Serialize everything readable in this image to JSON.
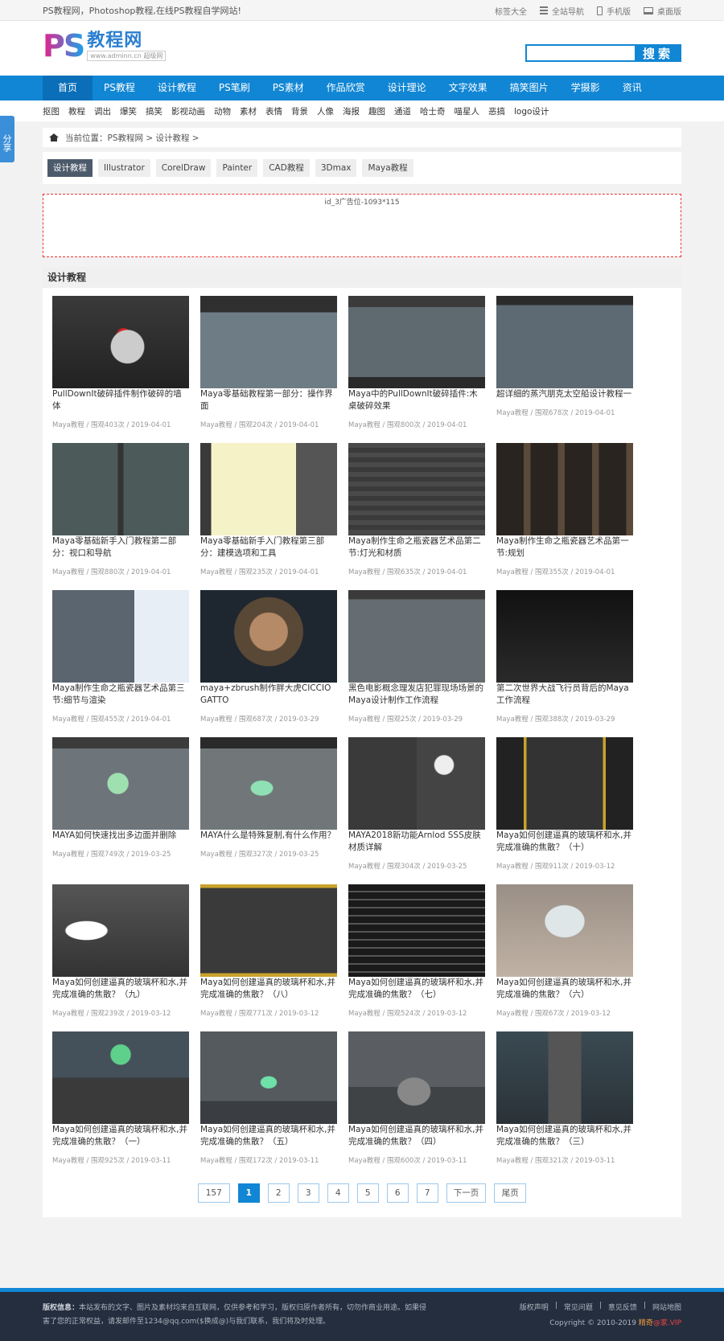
{
  "topbar": {
    "slogan": "PS教程网，Photoshop教程,在线PS教程自学网站!",
    "links": [
      "标签大全",
      "全站导航",
      "手机版",
      "桌面版"
    ]
  },
  "logo": {
    "ps": "PS",
    "cn": "教程网",
    "url": "www.adminn.cn 超级网"
  },
  "search": {
    "value": "",
    "button": "搜索"
  },
  "nav": [
    "首页",
    "PS教程",
    "设计教程",
    "PS笔刷",
    "PS素材",
    "作品欣赏",
    "设计理论",
    "文字效果",
    "搞笑图片",
    "学摄影",
    "资讯"
  ],
  "subnav": [
    "抠图",
    "教程",
    "调出",
    "爆笑",
    "搞笑",
    "影视动画",
    "动物",
    "素材",
    "表情",
    "背景",
    "人像",
    "海报",
    "趣图",
    "通道",
    "哈士奇",
    "喵星人",
    "恶搞",
    "logo设计"
  ],
  "share": "分享",
  "breadcrumb": "当前位置：PS教程网 > 设计教程 >",
  "categories": [
    "设计教程",
    "Illustrator",
    "CorelDraw",
    "Painter",
    "CAD教程",
    "3Dmax",
    "Maya教程"
  ],
  "ad": "id_3广告位-1093*115",
  "section_title": "设计教程",
  "articles": [
    {
      "title": "PullDownIt破碎插件制作破碎的墙体",
      "meta": "Maya教程 / 围观403次 / 2019-04-01"
    },
    {
      "title": "Maya零基础教程第一部分：操作界面",
      "meta": "Maya教程 / 围观204次 / 2019-04-01"
    },
    {
      "title": "Maya中的PullDownIt破碎插件:木桌破碎效果",
      "meta": "Maya教程 / 围观800次 / 2019-04-01"
    },
    {
      "title": "超详细的蒸汽朋克太空船设计教程一",
      "meta": "Maya教程 / 围观678次 / 2019-04-01"
    },
    {
      "title": "Maya零基础新手入门教程第二部分：视口和导航",
      "meta": "Maya教程 / 围观880次 / 2019-04-01"
    },
    {
      "title": "Maya零基础新手入门教程第三部分：建模选项和工具",
      "meta": "Maya教程 / 围观235次 / 2019-04-01"
    },
    {
      "title": "Maya制作生命之瓶瓷器艺术品第二节:灯光和材质",
      "meta": "Maya教程 / 围观635次 / 2019-04-01"
    },
    {
      "title": "Maya制作生命之瓶瓷器艺术品第一节:规划",
      "meta": "Maya教程 / 围观355次 / 2019-04-01"
    },
    {
      "title": "Maya制作生命之瓶瓷器艺术品第三节:细节与渲染",
      "meta": "Maya教程 / 围观455次 / 2019-04-01"
    },
    {
      "title": "maya+zbrush制作胖大虎CICCIO GATTO",
      "meta": "Maya教程 / 围观687次 / 2019-03-29"
    },
    {
      "title": "黑色电影概念理发店犯罪现场场景的Maya设计制作工作流程",
      "meta": "Maya教程 / 围观25次 / 2019-03-29"
    },
    {
      "title": "第二次世界大战飞行员背后的Maya工作流程",
      "meta": "Maya教程 / 围观388次 / 2019-03-29"
    },
    {
      "title": "MAYA如何快速找出多边面并删除",
      "meta": "Maya教程 / 围观749次 / 2019-03-25"
    },
    {
      "title": "MAYA什么是特殊复制,有什么作用？",
      "meta": "Maya教程 / 围观327次 / 2019-03-25"
    },
    {
      "title": "MAYA2018新功能Arnlod SSS皮肤材质详解",
      "meta": "Maya教程 / 围观304次 / 2019-03-25"
    },
    {
      "title": "Maya如何创建逼真的玻璃杯和水,并完成准确的焦散？（十）",
      "meta": "Maya教程 / 围观911次 / 2019-03-12"
    },
    {
      "title": "Maya如何创建逼真的玻璃杯和水,并完成准确的焦散？（九）",
      "meta": "Maya教程 / 围观239次 / 2019-03-12"
    },
    {
      "title": "Maya如何创建逼真的玻璃杯和水,并完成准确的焦散？（八）",
      "meta": "Maya教程 / 围观771次 / 2019-03-12"
    },
    {
      "title": "Maya如何创建逼真的玻璃杯和水,并完成准确的焦散？（七）",
      "meta": "Maya教程 / 围观524次 / 2019-03-12"
    },
    {
      "title": "Maya如何创建逼真的玻璃杯和水,并完成准确的焦散？（六）",
      "meta": "Maya教程 / 围观67次 / 2019-03-12"
    },
    {
      "title": "Maya如何创建逼真的玻璃杯和水,并完成准确的焦散？（一）",
      "meta": "Maya教程 / 围观925次 / 2019-03-11"
    },
    {
      "title": "Maya如何创建逼真的玻璃杯和水,并完成准确的焦散？（五）",
      "meta": "Maya教程 / 围观172次 / 2019-03-11"
    },
    {
      "title": "Maya如何创建逼真的玻璃杯和水,并完成准确的焦散？（四）",
      "meta": "Maya教程 / 围观600次 / 2019-03-11"
    },
    {
      "title": "Maya如何创建逼真的玻璃杯和水,并完成准确的焦散？（三）",
      "meta": "Maya教程 / 围观321次 / 2019-03-11"
    }
  ],
  "pager": [
    "157",
    "1",
    "2",
    "3",
    "4",
    "5",
    "6",
    "7",
    "下一页",
    "尾页"
  ],
  "footer": {
    "label": "版权信息：",
    "notice": "本站发布的文字、图片及素材均来自互联网，仅供参考和学习，版权归原作者所有，切勿作商业用途。如果侵害了您的正常权益，请发邮件至1234@qq.com($换成@)与我们联系，我们将及时处理。",
    "links": [
      "版权声明",
      "常见问题",
      "意见反馈",
      "网站地图"
    ],
    "copyright": "Copyright © 2010-2019",
    "brand1": "精奇",
    "brand2": "@家.VIP"
  }
}
